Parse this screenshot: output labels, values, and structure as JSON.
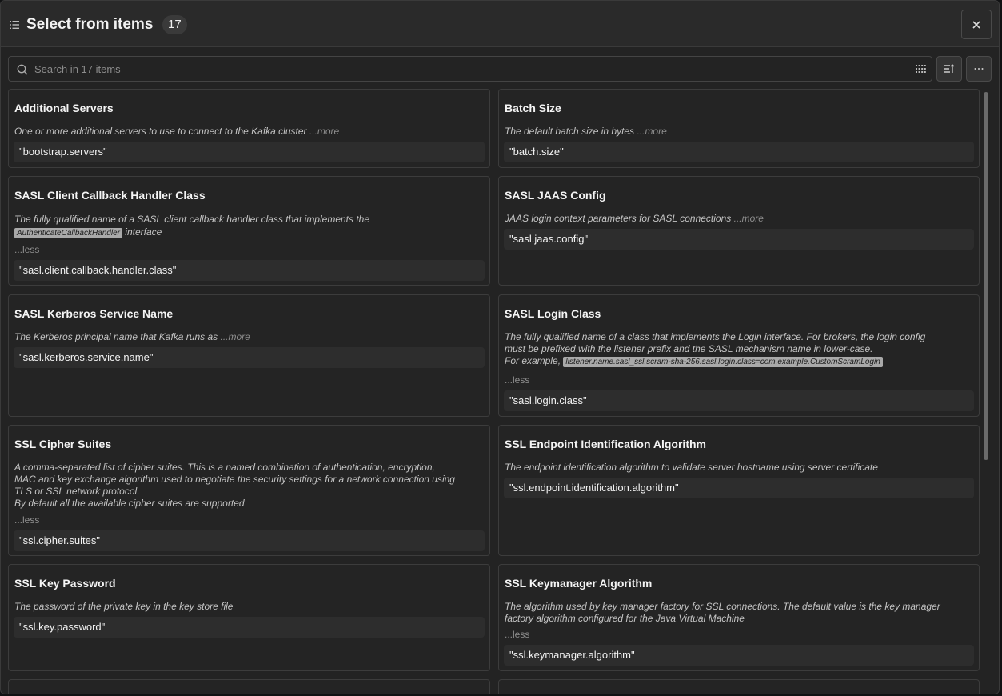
{
  "header": {
    "title": "Select from items",
    "count": "17"
  },
  "search": {
    "placeholder": "Search in 17 items"
  },
  "cards": [
    {
      "title": "Additional Servers",
      "desc": "One or more additional servers to use to connect to the Kafka cluster",
      "more": "...more",
      "value": "\"bootstrap.servers\""
    },
    {
      "title": "Batch Size",
      "desc": "The default batch size in bytes",
      "more": "...more",
      "value": "\"batch.size\""
    },
    {
      "title": "SASL Client Callback Handler Class",
      "desc_pre": "The fully qualified name of a SASL client callback handler class that implements the",
      "code": "AuthenticateCallbackHandler",
      "desc_post": " interface",
      "less": "...less",
      "value": "\"sasl.client.callback.handler.class\""
    },
    {
      "title": "SASL JAAS Config",
      "desc": "JAAS login context parameters for SASL connections",
      "more": "...more",
      "value": "\"sasl.jaas.config\""
    },
    {
      "title": "SASL Kerberos Service Name",
      "desc": "The Kerberos principal name that Kafka runs as",
      "more": "...more",
      "value": "\"sasl.kerberos.service.name\""
    },
    {
      "title": "SASL Login Class",
      "desc_line1": "The fully qualified name of a class that implements the Login interface. For brokers, the login config",
      "desc_line2": "must be prefixed with the listener prefix and the SASL mechanism name in lower-case.",
      "desc_line3": "For example,",
      "code": "listener.name.sasl_ssl.scram-sha-256.sasl.login.class=com.example.CustomScramLogin",
      "less": "...less",
      "value": "\"sasl.login.class\""
    },
    {
      "title": "SSL Cipher Suites",
      "desc_line1": "A comma-separated list of cipher suites. This is a named combination of authentication, encryption,",
      "desc_line2": "MAC and key exchange algorithm used to negotiate the security settings for a network connection using",
      "desc_line3": "TLS or SSL network protocol.",
      "desc_line4": "By default all the available cipher suites are supported",
      "less": "...less",
      "value": "\"ssl.cipher.suites\""
    },
    {
      "title": "SSL Endpoint Identification Algorithm",
      "desc": "The endpoint identification algorithm to validate server hostname using server certificate",
      "value": "\"ssl.endpoint.identification.algorithm\""
    },
    {
      "title": "SSL Key Password",
      "desc": "The password of the private key in the key store file",
      "value": "\"ssl.key.password\""
    },
    {
      "title": "SSL Keymanager Algorithm",
      "desc_line1": "The algorithm used by key manager factory for SSL connections. The default value is the key manager",
      "desc_line2": "factory algorithm configured for the Java Virtual Machine",
      "less": "...less",
      "value": "\"ssl.keymanager.algorithm\""
    }
  ]
}
